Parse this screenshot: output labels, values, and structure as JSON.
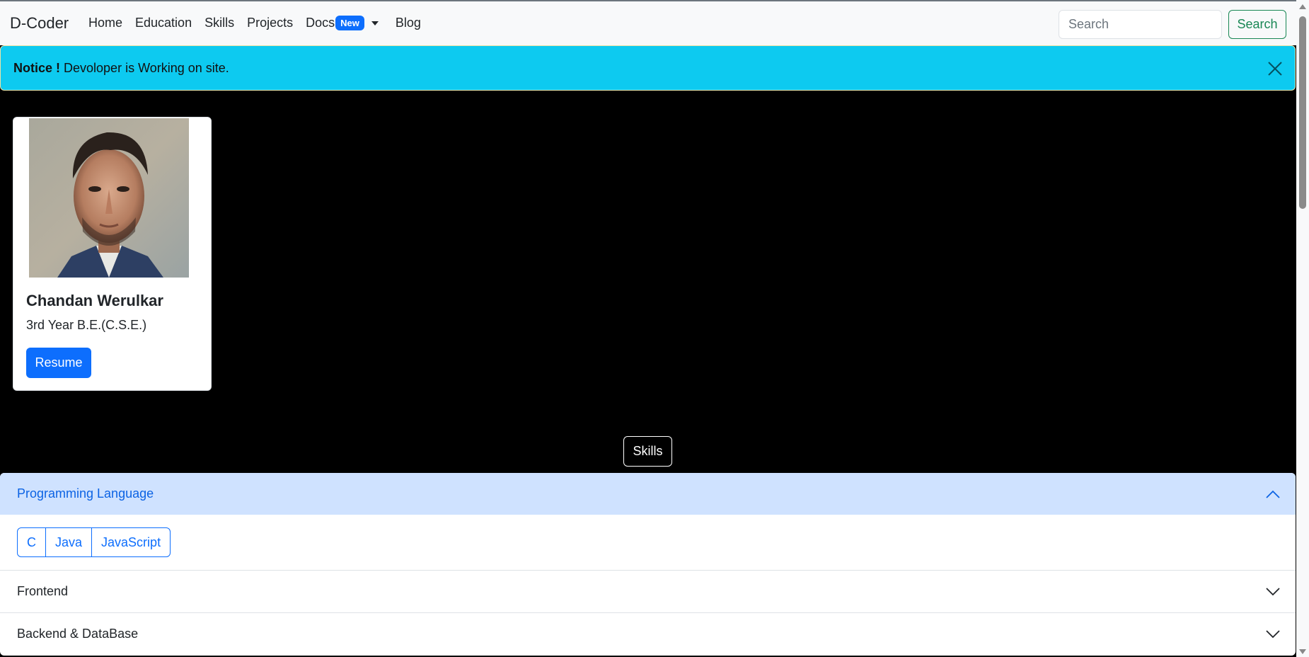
{
  "navbar": {
    "brand": "D-Coder",
    "links": [
      "Home",
      "Education",
      "Skills",
      "Projects"
    ],
    "docs_label": "Docs",
    "docs_badge": "New",
    "blog_label": "Blog",
    "search_placeholder": "Search",
    "search_value": "",
    "search_button": "Search"
  },
  "alert": {
    "strong": "Notice !",
    "message": " Devoloper is Working on site.",
    "close_icon": "close-icon"
  },
  "profile": {
    "name": "Chandan Werulkar",
    "subtitle": "3rd Year B.E.(C.S.E.)",
    "button": "Resume",
    "image": "portrait-photo"
  },
  "skills": {
    "heading_button": "Skills",
    "sections": [
      {
        "title": "Programming Language",
        "open": true,
        "items": [
          "C",
          "Java",
          "JavaScript"
        ]
      },
      {
        "title": "Frontend",
        "open": false
      },
      {
        "title": "Backend & DataBase",
        "open": false
      }
    ]
  },
  "colors": {
    "primary": "#0d6efd",
    "success": "#198754",
    "info": "#0dcaf0",
    "accordion_active_bg": "#cfe2ff",
    "page_bg": "#000000"
  }
}
